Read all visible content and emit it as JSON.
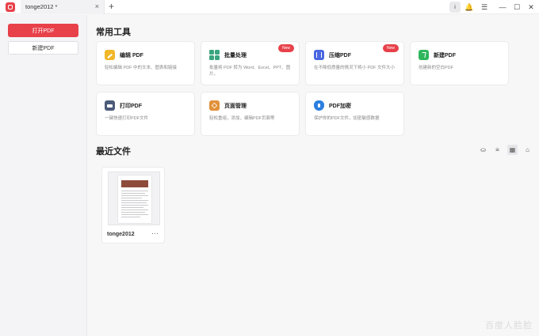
{
  "window": {
    "tab_title": "tonge2012 *",
    "tab_close": "×",
    "tab_add": "+",
    "info_label": "i",
    "bell_icon": "🔔",
    "menu_icon": "☰",
    "min_icon": "—",
    "max_icon": "☐",
    "close_icon": "✕"
  },
  "sidebar": {
    "open_label": "打开PDF",
    "new_label": "新建PDF"
  },
  "tools": {
    "title": "常用工具",
    "cards": [
      {
        "title": "编辑 PDF",
        "desc": "轻松编辑 PDF 中的文本、图表和链接",
        "badge": ""
      },
      {
        "title": "批量处理",
        "desc": "批量将 PDF 转为 Word、Excel、PPT、图片。",
        "badge": "New"
      },
      {
        "title": "压缩PDF",
        "desc": "在不降低质量的情况下将小 PDF 文件大小",
        "badge": "New"
      },
      {
        "title": "新建PDF",
        "desc": "创建新的空白PDF",
        "badge": ""
      },
      {
        "title": "打印PDF",
        "desc": "一键快速打印PDF文件",
        "badge": ""
      },
      {
        "title": "页面管理",
        "desc": "轻松重组，添加，编辑PDF页面等",
        "badge": ""
      },
      {
        "title": "PDF加密",
        "desc": "保护你的PDF文件，加密敏感数据",
        "badge": ""
      }
    ]
  },
  "recent": {
    "title": "最近文件",
    "view_icons": [
      "⛀",
      "≡",
      "▦",
      "⌂"
    ],
    "files": [
      {
        "name": "tonge2012",
        "more": "···"
      }
    ]
  },
  "watermark": "百度人脸脸"
}
